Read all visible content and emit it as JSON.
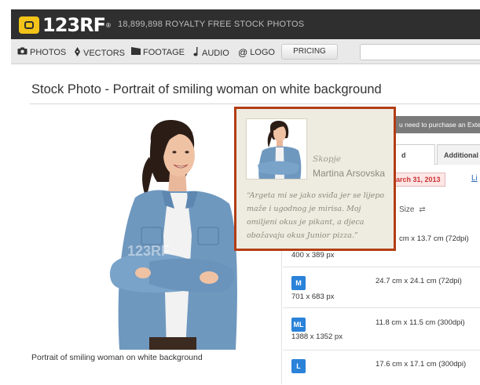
{
  "header": {
    "logo_text": "123RF",
    "logo_reg": "®",
    "tagline": "18,899,898  ROYALTY FREE STOCK PHOTOS"
  },
  "nav": {
    "items": [
      {
        "label": "PHOTOS",
        "icon": "camera-icon"
      },
      {
        "label": "VECTORS",
        "icon": "pen-nib-icon"
      },
      {
        "label": "FOOTAGE",
        "icon": "film-icon"
      },
      {
        "label": "AUDIO",
        "icon": "music-note-icon"
      },
      {
        "label": "LOGO",
        "icon": "at-sign-icon"
      }
    ],
    "pricing_label": "PRICING",
    "search_value": ""
  },
  "page": {
    "title": "Stock Photo - Portrait of smiling woman on white background",
    "caption": "Portrait of smiling woman on white background"
  },
  "watermark": "123RF",
  "right_panel": {
    "license_notice": "u need to purchase an Extende",
    "tabs": [
      "d License",
      "Additional"
    ],
    "date_badge": "arch 31, 2013",
    "link_fragment": "Li",
    "size_header": "Size",
    "sizes": [
      {
        "badge": "",
        "px": "400 x 389 px",
        "cm": "cm x 13.7 cm (72dpi)"
      },
      {
        "badge": "M",
        "px": "701 x 683 px",
        "cm": "24.7 cm x 24.1 cm (72dpi)"
      },
      {
        "badge": "ML",
        "px": "1388 x 1352 px",
        "cm": "11.8 cm x 11.5 cm (300dpi)"
      },
      {
        "badge": "L",
        "px": "",
        "cm": "17.6 cm x 17.1 cm (300dpi)"
      }
    ]
  },
  "popup": {
    "city": "Skopje",
    "name": "Martina Arsovska",
    "quote": "“Argeta mi se jako sviđa jer se lijepo maže i ugodnog je mirisa. Moj omiljeni okus je pikant, a djeca obožavaju okus Junior pizza.”"
  },
  "colors": {
    "header_bg": "#2f2f2f",
    "logo_accent": "#f2c318",
    "popup_border": "#b23d14",
    "popup_bg": "#eeebe0",
    "size_badge": "#2b82d9",
    "date_badge_text": "#cc3333"
  }
}
